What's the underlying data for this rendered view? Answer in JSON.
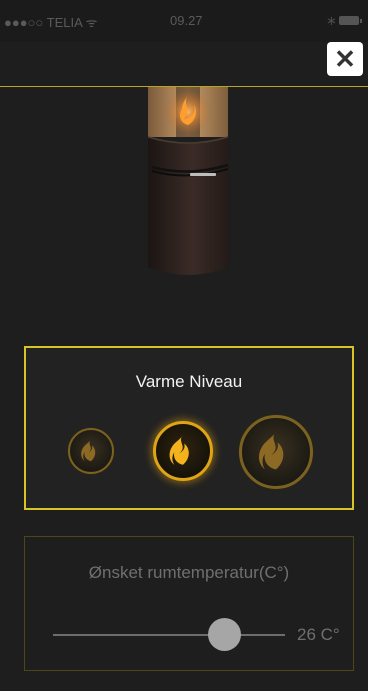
{
  "status_bar": {
    "carrier": "●●●○○ TELIA ᯤ",
    "time": "09.27",
    "bluetooth": "∗"
  },
  "close_button": {
    "label": "✕"
  },
  "heat_level": {
    "title": "Varme Niveau",
    "levels": [
      "low",
      "medium",
      "high"
    ],
    "selected": "medium",
    "accent_color": "#d9c522",
    "active_color": "#e0a514"
  },
  "room_temperature": {
    "title": "Ønsket rumtemperatur(C°)",
    "value_label": "26 C°",
    "slider_fraction": 0.74
  }
}
